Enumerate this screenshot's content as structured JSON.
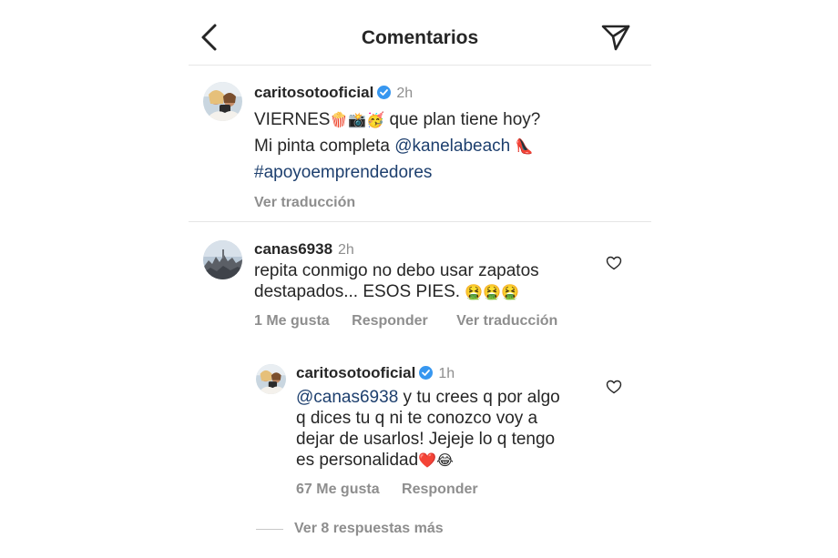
{
  "header": {
    "title": "Comentarios",
    "back_icon": "chevron-left-icon",
    "share_icon": "paper-plane-icon"
  },
  "caption": {
    "username": "caritosotooficial",
    "verified": true,
    "time": "2h",
    "line1_text": "VIERNES",
    "line1_emojis": "🍿📸🥳",
    "line1_rest": "que plan tiene hoy?",
    "line2_text": "Mi pinta completa",
    "line2_mention": "@kanelabeach",
    "line2_emoji": "👠",
    "line3_hashtag": "#apoyoemprendedores",
    "translate": "Ver traducción"
  },
  "comment": {
    "username": "canas6938",
    "time": "2h",
    "line1": "repita conmigo no debo usar zapatos",
    "line2_text": "destapados... ESOS PIES.",
    "line2_emojis": "🤮🤮🤮",
    "likes": "1 Me gusta",
    "reply": "Responder",
    "translate": "Ver traducción"
  },
  "reply": {
    "username": "caritosotooficial",
    "verified": true,
    "time": "1h",
    "mention": "@canas6938",
    "line1_rest": "y tu crees q por algo",
    "line2": "q dices tu q ni te conozco voy a",
    "line3": "dejar de usarlos! Jejeje lo q tengo",
    "line4_text": "es personalidad",
    "line4_emojis": "❤️😂",
    "likes": "67 Me gusta",
    "reply": "Responder"
  },
  "view_more": "Ver 8 respuestas más",
  "colors": {
    "text": "#262626",
    "secondary": "#8e8e8e",
    "link": "#1d3f6e",
    "verified": "#3797f0"
  }
}
